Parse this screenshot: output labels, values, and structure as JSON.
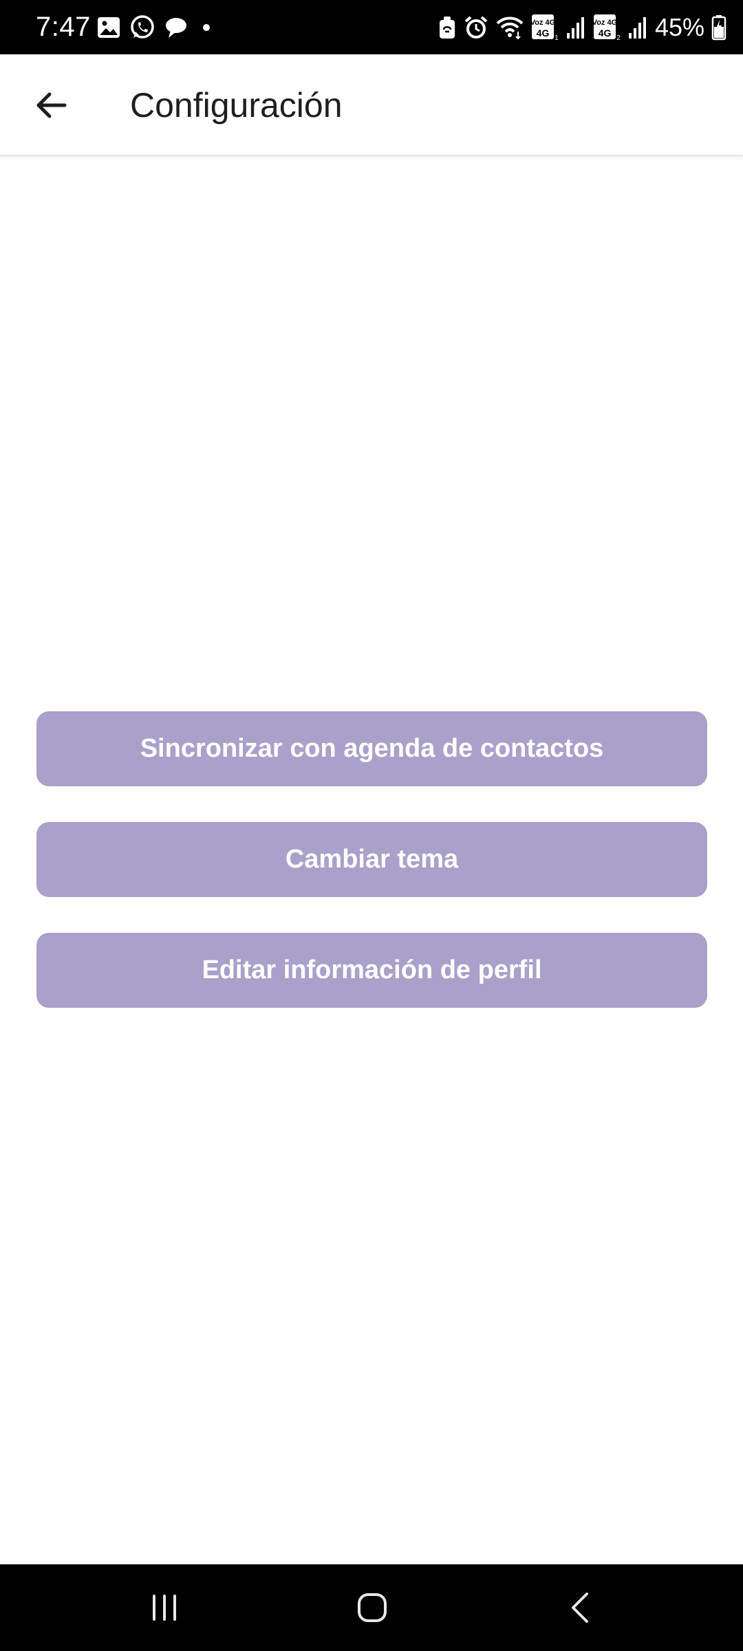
{
  "status_bar": {
    "time": "7:47",
    "battery_percent": "45%",
    "network": [
      "Voz 4G",
      "Voz 4G"
    ],
    "left_icons": [
      "gallery-icon",
      "whatsapp-icon",
      "chat-bubble-icon",
      "dot-icon"
    ],
    "right_icons": [
      "nfc-icon",
      "alarm-icon",
      "wifi-icon",
      "volte-4g-sim1-icon",
      "signal-icon",
      "volte-4g-sim2-icon",
      "signal-icon",
      "battery-charging-icon"
    ]
  },
  "app_bar": {
    "title": "Configuración",
    "back_icon": "arrow-left-icon"
  },
  "actions": {
    "sync_contacts": "Sincronizar con agenda de contactos",
    "change_theme": "Cambiar tema",
    "edit_profile": "Editar información de perfil"
  },
  "nav_bar": {
    "icons": [
      "recents-icon",
      "home-icon",
      "back-icon"
    ]
  },
  "colors": {
    "status_bar": "#000000",
    "app_bar": "#ffffff",
    "button_bg": "#a9a1c9",
    "button_text": "#ffffff",
    "title_text": "#1e1e1e",
    "nav_bar": "#000000"
  }
}
